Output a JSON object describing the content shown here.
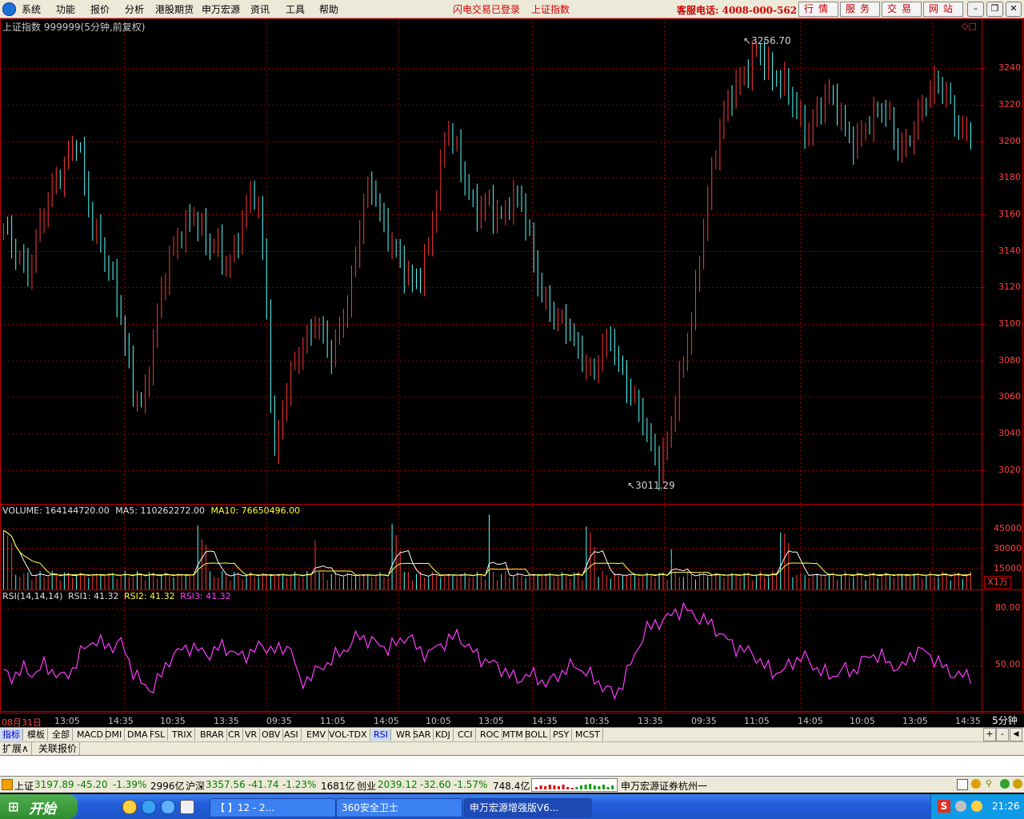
{
  "menu": {
    "items": [
      "系统",
      "功能",
      "报价",
      "分析",
      "港股期货",
      "申万宏源",
      "资讯",
      "工具",
      "帮助"
    ],
    "status_flash": "闪电交易已登录",
    "status_index": "上证指数",
    "hotline": "客服电话: 4008-000-562",
    "buttons": [
      "行情",
      "服务",
      "交易",
      "网站"
    ],
    "window_controls": [
      "minimize-icon",
      "restore-icon",
      "close-icon"
    ]
  },
  "chart": {
    "title": "上证指数 999999(5分钟,前复权)",
    "high_label": "3256.70",
    "low_label": "3011.29",
    "price_ticks": [
      "3240",
      "3220",
      "3200",
      "3180",
      "3160",
      "3140",
      "3120",
      "3100",
      "3080",
      "3060",
      "3040",
      "3020"
    ],
    "volume_line": {
      "volume": "VOLUME: 164144720.00",
      "ma5": "MA5: 110262272.00",
      "ma10": "MA10: 76650496.00"
    },
    "volume_ticks": [
      "45000",
      "30000",
      "15000"
    ],
    "volume_unit": "X1万",
    "rsi_line": {
      "params": "RSI(14,14,14)",
      "rsi1": "RSI1: 41.32",
      "rsi2": "RSI2: 41.32",
      "rsi3": "RSI3: 41.32"
    },
    "rsi_ticks": [
      "80.00",
      "50.00"
    ],
    "time_labels": [
      "08月31日",
      "13:05",
      "14:35",
      "10:35",
      "13:35",
      "09:35",
      "11:05",
      "14:05",
      "10:05",
      "13:05",
      "14:35",
      "10:35",
      "13:35",
      "09:35",
      "11:05",
      "14:05",
      "10:05",
      "13:05",
      "14:35"
    ],
    "period": "5分钟",
    "colors": {
      "up": "#ff3a3a",
      "down": "#54ffff",
      "ma5": "#ffffff",
      "ma10": "#ffff40",
      "rsi": "#ff3cff",
      "grid": "#8b0000"
    }
  },
  "chart_data": {
    "type": "candlestick",
    "title": "上证指数 999999(5分钟,前复权)",
    "ylim": [
      3005,
      3262
    ],
    "high": 3256.7,
    "low": 3011.29,
    "close_series": [
      3150,
      3142,
      3138,
      3130,
      3145,
      3160,
      3175,
      3185,
      3196,
      3200,
      3170,
      3150,
      3145,
      3130,
      3110,
      3080,
      3060,
      3058,
      3085,
      3110,
      3130,
      3145,
      3155,
      3162,
      3150,
      3140,
      3145,
      3135,
      3138,
      3152,
      3168,
      3170,
      3120,
      3025,
      3050,
      3070,
      3085,
      3095,
      3102,
      3090,
      3080,
      3100,
      3115,
      3140,
      3165,
      3175,
      3160,
      3150,
      3138,
      3125,
      3120,
      3130,
      3150,
      3175,
      3205,
      3198,
      3185,
      3170,
      3160,
      3165,
      3158,
      3162,
      3172,
      3168,
      3148,
      3125,
      3115,
      3108,
      3100,
      3095,
      3085,
      3080,
      3075,
      3085,
      3090,
      3078,
      3070,
      3060,
      3045,
      3030,
      3020,
      3040,
      3060,
      3080,
      3100,
      3140,
      3175,
      3200,
      3215,
      3225,
      3235,
      3245,
      3252,
      3240,
      3230,
      3235,
      3228,
      3215,
      3200,
      3210,
      3225,
      3230,
      3215,
      3200,
      3195,
      3210,
      3215,
      3220,
      3210,
      3195,
      3198,
      3210,
      3218,
      3225,
      3230,
      3228,
      3215,
      3205,
      3200
    ],
    "volume_ticks": [
      15000,
      30000,
      45000
    ],
    "rsi_series": [
      46,
      44,
      48,
      45,
      50,
      47,
      43,
      48,
      58,
      63,
      61,
      60,
      62,
      48,
      40,
      37,
      45,
      55,
      58,
      60,
      57,
      56,
      60,
      58,
      54,
      57,
      60,
      59,
      57,
      62,
      40,
      44,
      48,
      52,
      56,
      60,
      66,
      63,
      61,
      59,
      62,
      66,
      58,
      56,
      60,
      63,
      66,
      60,
      55,
      52,
      50,
      46,
      42,
      45,
      44,
      40,
      44,
      48,
      50,
      46,
      42,
      38,
      34,
      44,
      56,
      68,
      72,
      74,
      78,
      80,
      76,
      74,
      70,
      65,
      60,
      58,
      56,
      50,
      46,
      47,
      52,
      55,
      50,
      46,
      44,
      48,
      46,
      52,
      56,
      54,
      50,
      48,
      56,
      58,
      55,
      50,
      46,
      44,
      45
    ],
    "rsi_ylim": [
      25,
      90
    ]
  },
  "tabs": [
    "指标",
    "模板",
    "全部",
    "MACD",
    "DMI",
    "DMA",
    "FSL",
    "TRIX",
    "BRAR",
    "CR",
    "VR",
    "OBV",
    "ASI",
    "EMV",
    "VOL-TDX",
    "RSI",
    "WR",
    "SAR",
    "KDJ",
    "CCI",
    "ROC",
    "MTM",
    "BOLL",
    "PSY",
    "MCST"
  ],
  "active_tab": "RSI",
  "tabs2": [
    "扩展∧",
    "关联报价"
  ],
  "scroll_buttons": [
    "+",
    "-",
    "◀"
  ],
  "indexbar": {
    "sh_name": "上证",
    "sh_price": "3197.89",
    "sh_chg": "-45.20",
    "sh_pct": "-1.39%",
    "sh_amt": "2996亿",
    "hs_name": "沪深",
    "hs_price": "3357.56",
    "hs_chg": "-41.74",
    "hs_pct": "-1.23%",
    "hs_amt": "1681亿",
    "cy_name": "创业",
    "cy_price": "2039.12",
    "cy_chg": "-32.60",
    "cy_pct": "-1.57%",
    "cy_amt": "748.4亿",
    "broker": "申万宏源证券杭州一"
  },
  "taskbar": {
    "start": "开始",
    "tasks": [
      "【        】12 - 2...",
      "360安全卫士",
      "申万宏源增强版V6..."
    ],
    "clock": "21:26"
  }
}
